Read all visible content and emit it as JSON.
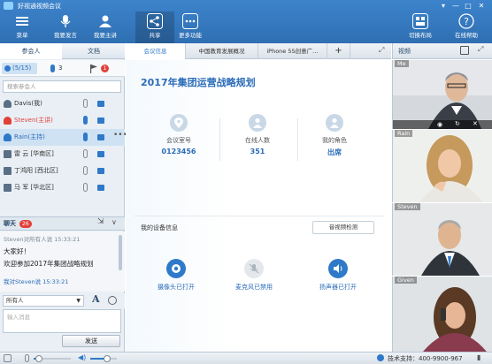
{
  "window": {
    "title": "好视通视频会议",
    "controls": [
      "▾",
      "—",
      "□",
      "✕"
    ]
  },
  "toolbar": {
    "menu": "菜单",
    "request_speak": "我要发言",
    "request_host": "我要主讲",
    "share": "共享",
    "more": "更多功能",
    "switch_layout": "切换布局",
    "online_help": "在线帮助"
  },
  "left_panel": {
    "tabs": [
      "参会人",
      "文档"
    ],
    "counts": {
      "people": "(5/15)",
      "mic": "3",
      "flag": "1"
    },
    "search_placeholder": "搜索参会人",
    "participants": [
      {
        "name": "Davis(我)",
        "color": "#333333"
      },
      {
        "name": "Steven(主讲)",
        "color": "#e0423a"
      },
      {
        "name": "Rain(主持)",
        "color": "#2a6cb8"
      },
      {
        "name": "雷  云 [华南区]",
        "color": "#333333"
      },
      {
        "name": "丁鸿阳 [西北区]",
        "color": "#333333"
      },
      {
        "name": "马  军 [华北区]",
        "color": "#333333"
      }
    ],
    "chat": {
      "title": "聊天",
      "badge": "26",
      "messages": [
        {
          "header": "Steven对所有人说  15:33:21",
          "body": "大家好！"
        },
        {
          "header": "",
          "body": "欢迎参加2017年集团战略规划"
        },
        {
          "header": "我对Steven说  15:33:21",
          "body": ""
        }
      ],
      "recipient": "所有人",
      "input_placeholder": "输入消息",
      "send": "发送"
    }
  },
  "center": {
    "tabs": [
      "会议信息",
      "中国教育发展概况",
      "iPhone 5S创意广…",
      "+"
    ],
    "meeting_title": "2017年集团运营战略规划",
    "stats": [
      {
        "label": "会议室号",
        "value": "0123456"
      },
      {
        "label": "在线人数",
        "value": "351"
      },
      {
        "label": "我的角色",
        "value": "出席"
      }
    ],
    "device_label": "我的设备信息",
    "detect_button": "音视频检测",
    "devices": [
      {
        "label": "摄像头已打开"
      },
      {
        "label": "麦克风已禁用"
      },
      {
        "label": "扬声器已打开"
      }
    ]
  },
  "right_panel": {
    "title": "视频",
    "videos": [
      "Me",
      "Rain",
      "Steven",
      "Given"
    ]
  },
  "status": {
    "support": "技术支持：400-9900-967"
  },
  "colors": {
    "brand_blue": "#2f6fb2",
    "accent_red": "#e0423a",
    "text_blue": "#2a6cb8"
  }
}
